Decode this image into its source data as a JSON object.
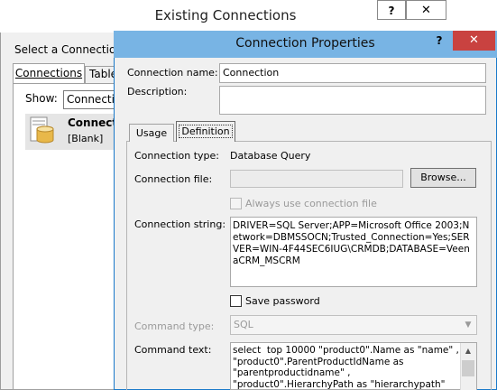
{
  "back_window": {
    "title": "Existing Connections",
    "help_label": "?",
    "close_label": "✕",
    "prompt": "Select a Connection or",
    "tabs": [
      "Connections",
      "Tables"
    ],
    "show_label": "Show:",
    "show_value": "Connection",
    "list_item": {
      "name": "Connection",
      "subtitle": "[Blank]"
    }
  },
  "dialog": {
    "title": "Connection Properties",
    "help_label": "?",
    "close_label": "✕",
    "connection_name_label": "Connection name:",
    "connection_name_value": "Connection",
    "description_label": "Description:",
    "description_value": "",
    "tabs": [
      "Usage",
      "Definition"
    ],
    "active_tab": "Definition",
    "definition": {
      "connection_type_label": "Connection type:",
      "connection_type_value": "Database Query",
      "connection_file_label": "Connection file:",
      "connection_file_value": "",
      "browse_label": "Browse...",
      "always_use_label": "Always use connection file",
      "always_use_checked": false,
      "connection_string_label": "Connection string:",
      "connection_string_value": "DRIVER=SQL Server;APP=Microsoft Office 2003;Network=DBMSSOCN;Trusted_Connection=Yes;SERVER=WIN-4F44SEC6IUG\\CRMDB;DATABASE=VeenaCRM_MSCRM",
      "save_password_label": "Save password",
      "save_password_checked": false,
      "command_type_label": "Command type:",
      "command_type_value": "SQL",
      "command_text_label": "Command text:",
      "command_text_value": "select  top 10000 \"product0\".Name as \"name\" ,\n\"product0\".ParentProductIdName as\n\"parentproductidname\" ,\n\"product0\".HierarchyPath as \"hierarchypath\""
    }
  }
}
